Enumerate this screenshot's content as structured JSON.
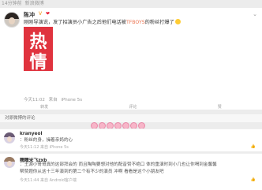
{
  "status": {
    "time": "14分钟前",
    "source": "新浪微博"
  },
  "post": {
    "username": "陈冲",
    "vip_label": "V",
    "badge": "❤",
    "text_before": "刚刚导演说，发了招演员小广告之后他们电话被",
    "text_link": "TFBOYS",
    "text_after": "的粉丝打爆了",
    "image_chars": [
      "热",
      "情"
    ],
    "time": "今天11:02",
    "via": "来自",
    "device": "iPhone 5s"
  },
  "actions": [
    {
      "label": "转发",
      "icon": "repost-icon"
    },
    {
      "label": "评论",
      "icon": "comment-icon"
    },
    {
      "label": "赞",
      "icon": "like-icon"
    }
  ],
  "section_title": "对原微博的评论",
  "comments": [
    {
      "username": "kranyeol",
      "text": "：粉丝的身，操着亲妈的心",
      "time": "今天11:12",
      "via": "来自",
      "device": "iPhone 5s"
    },
    {
      "username": "糯糯米飞zxb",
      "text_lines": [
        "：王源小哥哥真的这部拜会的 而且陶陶要想对他的配音赞不绝口 体的重演时到小几也让你喝到金馨馨",
        "帮赞题你从这十三年演到的第二个有不少的演员 冲啊 看看是这个小朋友吧"
      ],
      "time": "今天11:44",
      "via": "来自",
      "device": "Android客户端"
    }
  ]
}
